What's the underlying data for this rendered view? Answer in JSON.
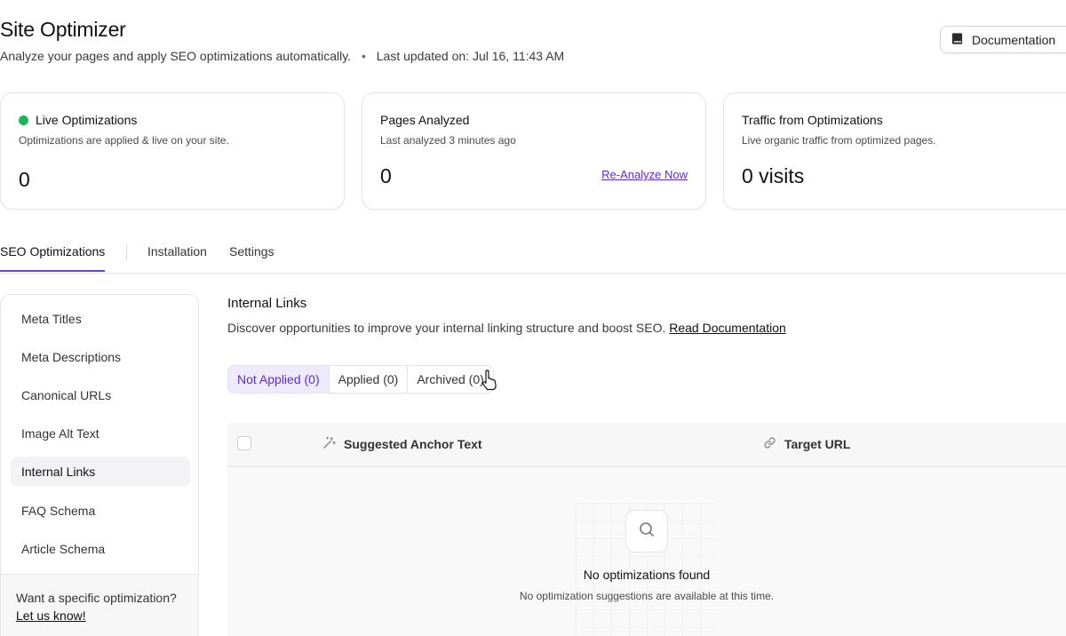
{
  "header": {
    "title": "Site Optimizer",
    "subtitle": "Analyze your pages and apply SEO optimizations automatically.",
    "separator": "•",
    "last_updated": "Last updated on: Jul 16, 11:43 AM",
    "documentation_label": "Documentation",
    "documentation_icon": "book-icon"
  },
  "cards": [
    {
      "title": "Live Optimizations",
      "subtitle": "Optimizations are applied & live on your site.",
      "value": "0",
      "status_color": "#1fb35a"
    },
    {
      "title": "Pages Analyzed",
      "subtitle": "Last analyzed 3 minutes ago",
      "value": "0",
      "action_label": "Re-Analyze Now"
    },
    {
      "title": "Traffic from Optimizations",
      "subtitle": "Live organic traffic from optimized pages.",
      "value": "0 visits"
    }
  ],
  "tabs": [
    {
      "label": "SEO Optimizations",
      "active": true
    },
    {
      "label": "Installation",
      "active": false
    },
    {
      "label": "Settings",
      "active": false
    }
  ],
  "sidebar": {
    "items": [
      {
        "label": "Meta Titles",
        "active": false
      },
      {
        "label": "Meta Descriptions",
        "active": false
      },
      {
        "label": "Canonical URLs",
        "active": false
      },
      {
        "label": "Image Alt Text",
        "active": false
      },
      {
        "label": "Internal Links",
        "active": true
      },
      {
        "label": "FAQ Schema",
        "active": false
      },
      {
        "label": "Article Schema",
        "active": false
      }
    ],
    "footer_question": "Want a specific optimization?",
    "footer_link": "Let us know!"
  },
  "main": {
    "title": "Internal Links",
    "description": "Discover opportunities to improve your internal linking structure and boost SEO.",
    "doc_link": "Read Documentation",
    "filters": [
      {
        "label": "Not Applied (0)",
        "active": true
      },
      {
        "label": "Applied (0)",
        "active": false
      },
      {
        "label": "Archived (0)",
        "active": false
      }
    ],
    "table": {
      "columns": [
        {
          "label": "Suggested Anchor Text",
          "icon": "magic-wand-icon"
        },
        {
          "label": "Target URL",
          "icon": "link-icon"
        }
      ],
      "empty_title": "No optimizations found",
      "empty_subtitle": "No optimization suggestions are available at this time.",
      "empty_icon": "search-icon"
    }
  },
  "colors": {
    "accent": "#6a3de8",
    "accent_text": "#5b2bd6",
    "active_filter_bg": "#efeafd",
    "live_green": "#1fb35a"
  }
}
